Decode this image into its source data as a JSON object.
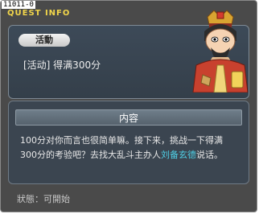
{
  "quest_id": "11011-0",
  "title": "QUEST INFO",
  "top": {
    "badge": "活動",
    "quest_name": "[活动] 得满300分"
  },
  "content": {
    "header": "内容",
    "line1": "100分对你而言也很简单嘛。接下来，挑战一下得满",
    "line2_pre": "300分的考验吧？去找大乱斗主办人",
    "npc_name": "刘备玄德",
    "line2_post": "说话。"
  },
  "status": "狀態：可開始",
  "colors": {
    "title": "#f2d64a",
    "highlight": "#4fd0e6",
    "panel": "#3b4550"
  },
  "icons": {
    "portrait": "npc-liubei-portrait"
  }
}
